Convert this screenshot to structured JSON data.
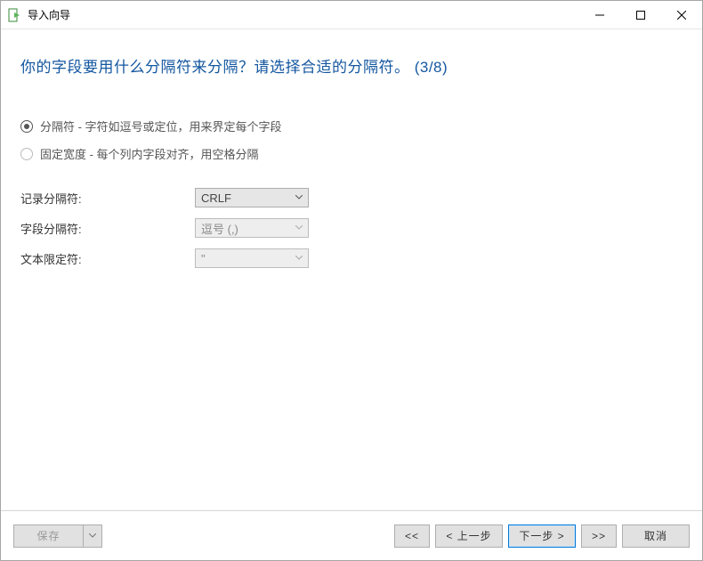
{
  "window": {
    "title": "导入向导"
  },
  "heading": "你的字段要用什么分隔符来分隔？请选择合适的分隔符。 (3/8)",
  "options": {
    "delimited": {
      "label": "分隔符 - 字符如逗号或定位，用来界定每个字段",
      "selected": true
    },
    "fixed": {
      "label": "固定宽度 - 每个列内字段对齐，用空格分隔",
      "selected": false
    }
  },
  "fields": {
    "record_sep": {
      "label": "记录分隔符:",
      "value": "CRLF"
    },
    "field_sep": {
      "label": "字段分隔符:",
      "value": "逗号 (,)"
    },
    "text_qual": {
      "label": "文本限定符:",
      "value": "\""
    }
  },
  "footer": {
    "save": "保存",
    "first": "<<",
    "back": "< 上一步",
    "next": "下一步 >",
    "last": ">>",
    "cancel": "取消"
  }
}
